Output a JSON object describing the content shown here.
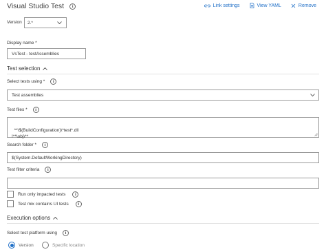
{
  "header": {
    "title": "Visual Studio Test",
    "links": {
      "link_settings": "Link settings",
      "view_yaml": "View YAML",
      "remove": "Remove"
    }
  },
  "version": {
    "label": "Version",
    "value": "2.*"
  },
  "display_name": {
    "label": "Display name *",
    "value": "VsTest - testAssemblies"
  },
  "test_selection": {
    "heading": "Test selection",
    "select_tests_label": "Select tests using *",
    "select_tests_value": "Test assemblies",
    "test_files_label": "Test files *",
    "test_files_value": "**\\$(BuildConfiguration)\\*test*.dll\n!**\\obj\\**",
    "search_folder_label": "Search folder *",
    "search_folder_value": "$(System.DefaultWorkingDirectory)",
    "filter_label": "Test filter criteria",
    "filter_value": "",
    "run_impacted_label": "Run only impacted tests",
    "ui_tests_label": "Test mix contains UI tests"
  },
  "execution_options": {
    "heading": "Execution options",
    "platform_label": "Select test platform using",
    "option_version": "Version",
    "option_specific": "Specific location"
  }
}
